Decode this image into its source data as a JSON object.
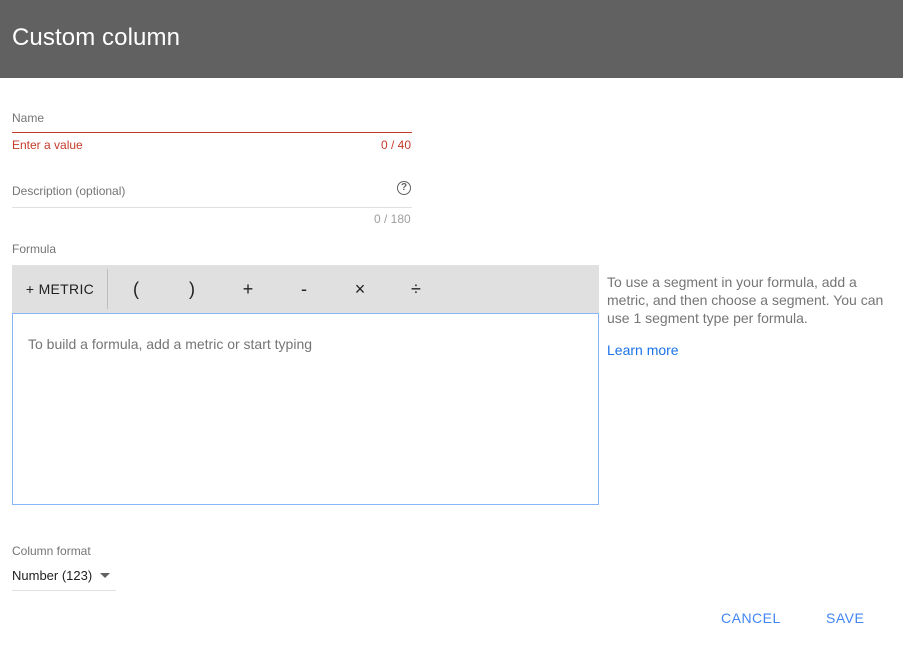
{
  "dialog": {
    "title": "Custom column"
  },
  "name_field": {
    "label": "Name",
    "error": "Enter a value",
    "counter": "0 / 40"
  },
  "description_field": {
    "label": "Description (optional)",
    "counter": "0 / 180",
    "help_icon": "help-circle-icon"
  },
  "formula": {
    "label": "Formula",
    "metric_button": "+ METRIC",
    "operators": [
      "(",
      ")",
      "+",
      "-",
      "×",
      "÷"
    ],
    "placeholder": "To build a formula, add a metric or start typing"
  },
  "side_help": {
    "text": "To use a segment in your formula, add a metric, and then choose a segment. You can use 1 segment type per formula.",
    "link": "Learn more"
  },
  "column_format": {
    "label": "Column format",
    "selected": "Number (123)"
  },
  "actions": {
    "cancel": "CANCEL",
    "save": "SAVE"
  },
  "colors": {
    "header_bg": "#616161",
    "error": "#c53929",
    "accent": "#4285f4",
    "toolbar_bg": "#e0e0e0"
  }
}
